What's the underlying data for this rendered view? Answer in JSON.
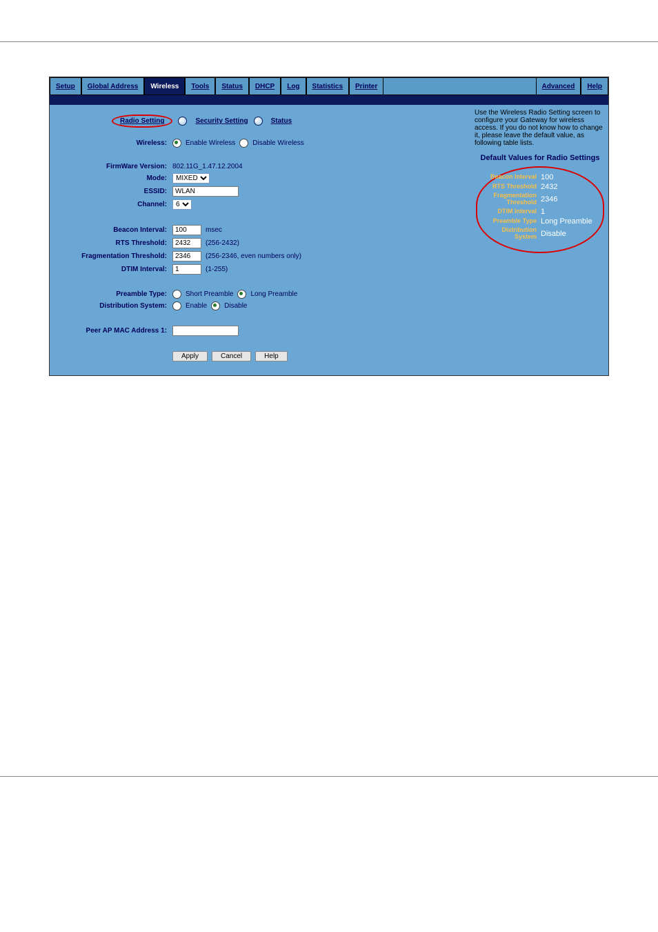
{
  "nav": {
    "setup": "Setup",
    "global": "Global Address",
    "wireless": "Wireless",
    "tools": "Tools",
    "status": "Status",
    "dhcp": "DHCP",
    "log": "Log",
    "stats": "Statistics",
    "printer": "Printer",
    "advanced": "Advanced",
    "help": "Help"
  },
  "sub": {
    "radio": "Radio Setting",
    "security": "Security Setting",
    "status": "Status"
  },
  "labels": {
    "wireless": "Wireless:",
    "fw": "FirmWare Version:",
    "mode": "Mode:",
    "essid": "ESSID:",
    "channel": "Channel:",
    "beacon": "Beacon Interval:",
    "rts": "RTS Threshold:",
    "frag": "Fragmentation Threshold:",
    "dtim": "DTIM Interval:",
    "preamble": "Preamble Type:",
    "dist": "Distribution System:",
    "peer": "Peer AP MAC Address 1:"
  },
  "opts": {
    "enableW": "Enable Wireless",
    "disableW": "Disable Wireless",
    "shortP": "Short Preamble",
    "longP": "Long Preamble",
    "enable": "Enable",
    "disable": "Disable"
  },
  "vals": {
    "fw": "802.11G_1.47.12.2004",
    "mode": "MIXED",
    "essid": "WLAN",
    "channel": "6",
    "beacon": "100",
    "rts": "2432",
    "frag": "2346",
    "dtim": "1",
    "mac": ""
  },
  "hints": {
    "msec": "msec",
    "rts": "(256-2432)",
    "frag": "(256-2346, even numbers only)",
    "dtim": "(1-255)"
  },
  "btns": {
    "apply": "Apply",
    "cancel": "Cancel",
    "help": "Help"
  },
  "side": {
    "p1": "Use the Wireless Radio Setting screen to configure your Gateway for wireless access. If you do not know how to change it, please leave the default value, as following table lists.",
    "head": "Default Values for Radio Settings",
    "r1n": "Beacon Interval",
    "r1v": "100",
    "r2n": "RTS Threshold",
    "r2v": "2432",
    "r3n": "Fragmentation Threshold",
    "r3v": "2346",
    "r4n": "DTIM Interval",
    "r4v": "1",
    "r5n": "Preamble Type",
    "r5v": "Long Preamble",
    "r6n": "Distribution System",
    "r6v": "Disable"
  }
}
